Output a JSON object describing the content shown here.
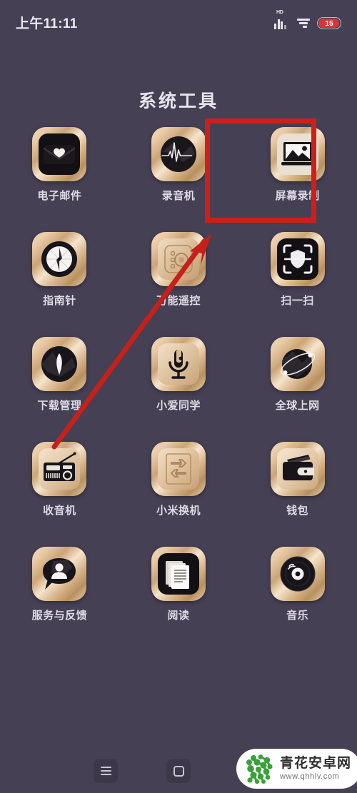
{
  "status_bar": {
    "time": "上午11:11",
    "signal_icon": "signal-bars-hd-icon",
    "signal_label": "HD",
    "wifi_icon": "wifi-signal-icon",
    "battery_icon": "battery-icon",
    "battery_level": "15"
  },
  "header": {
    "title": "系统工具"
  },
  "apps": [
    {
      "label": "电子邮件",
      "icon": "email-envelope-heart-icon"
    },
    {
      "label": "录音机",
      "icon": "voice-recorder-waveform-icon"
    },
    {
      "label": "屏幕录制",
      "icon": "screen-record-monitor-icon"
    },
    {
      "label": "指南针",
      "icon": "compass-icon"
    },
    {
      "label": "万能遥控",
      "icon": "universal-remote-icon"
    },
    {
      "label": "扫一扫",
      "icon": "scan-shield-icon"
    },
    {
      "label": "下载管理",
      "icon": "download-manager-icon"
    },
    {
      "label": "小爱同学",
      "icon": "xiaoai-microphone-icon"
    },
    {
      "label": "全球上网",
      "icon": "global-internet-planet-icon"
    },
    {
      "label": "收音机",
      "icon": "radio-icon"
    },
    {
      "label": "小米换机",
      "icon": "mi-mover-swap-icon"
    },
    {
      "label": "钱包",
      "icon": "wallet-icon"
    },
    {
      "label": "服务与反馈",
      "icon": "service-feedback-person-icon"
    },
    {
      "label": "阅读",
      "icon": "reading-documents-icon"
    },
    {
      "label": "音乐",
      "icon": "music-vinyl-record-icon"
    }
  ],
  "annotations": {
    "highlight_color": "#cf1f18",
    "highlight_target": "屏幕录制",
    "arrow_color": "#c5201a",
    "arrow_from": "74,624",
    "arrow_to": "293,330"
  },
  "nav_bar": {
    "menu_icon": "menu-hamburger-icon",
    "home_icon": "home-square-icon"
  },
  "watermark": {
    "logo_icon": "qinghua-molecule-logo-icon",
    "site_name": "青花安卓网",
    "site_url": "www.qhhlv.com",
    "logo_color": "#3aa13a"
  }
}
